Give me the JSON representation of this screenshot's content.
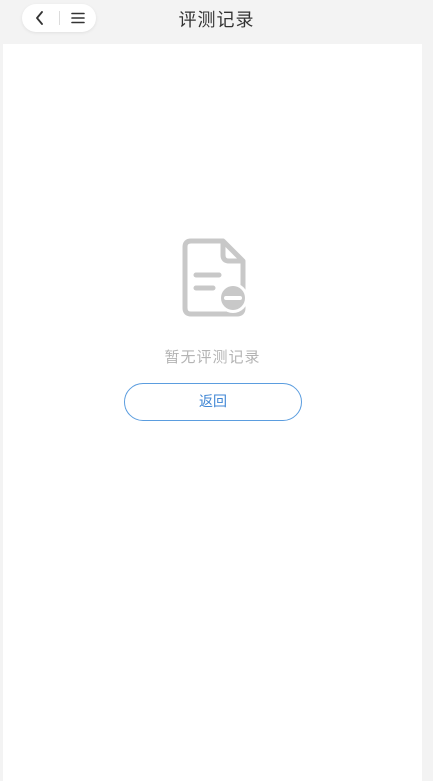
{
  "header": {
    "title": "评测记录",
    "back_icon": "chevron-left-icon",
    "menu_icon": "menu-icon"
  },
  "empty_state": {
    "icon": "document-minus-icon",
    "message": "暂无评测记录",
    "back_label": "返回"
  },
  "colors": {
    "accent": "#5b9ddf",
    "icon_gray": "#c8c8c8",
    "text_gray": "#b4b4b4"
  }
}
